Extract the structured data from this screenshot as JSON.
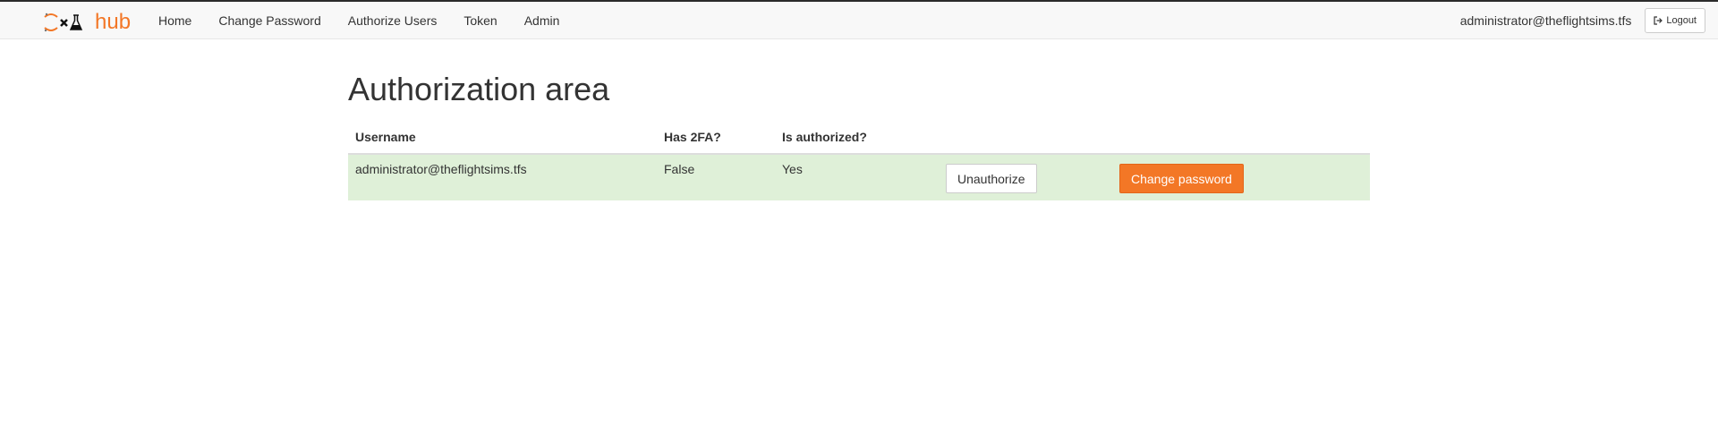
{
  "navbar": {
    "logo_text": "hub",
    "links": [
      {
        "label": "Home"
      },
      {
        "label": "Change Password"
      },
      {
        "label": "Authorize Users"
      },
      {
        "label": "Token"
      },
      {
        "label": "Admin"
      }
    ],
    "user": "administrator@theflightsims.tfs",
    "logout_label": "Logout"
  },
  "page": {
    "title": "Authorization area"
  },
  "table": {
    "headers": [
      "Username",
      "Has 2FA?",
      "Is authorized?"
    ],
    "rows": [
      {
        "username": "administrator@theflightsims.tfs",
        "has_2fa": "False",
        "is_authorized": "Yes",
        "unauthorize_label": "Unauthorize",
        "change_password_label": "Change password"
      }
    ]
  },
  "colors": {
    "accent": "#f37726",
    "row_success": "#dff0d8",
    "navbar_bg": "#f8f8f8"
  },
  "icons": {
    "logo": "jupyter-logo-icon",
    "logout": "sign-out-icon"
  }
}
